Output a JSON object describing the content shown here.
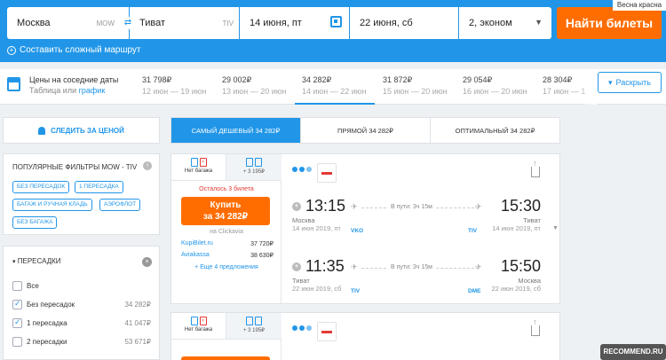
{
  "watermark_top": "Весна красна",
  "search": {
    "from_city": "Москва",
    "from_iata": "MOW",
    "to_city": "Тиват",
    "to_iata": "TIV",
    "depart_date": "14 июня, пт",
    "return_date": "22 июня, сб",
    "passengers": "2, эконом",
    "search_label": "Найти билеты",
    "complex_route": "Составить сложный маршрут"
  },
  "price_strip": {
    "title": "Цены на соседние даты",
    "sub_prefix": "Таблица или ",
    "sub_link": "график",
    "expand_label": "Раскрыть",
    "cells": [
      {
        "price": "31 798₽",
        "dates": "12 июн — 19 июн"
      },
      {
        "price": "29 002₽",
        "dates": "13 июн — 20 июн"
      },
      {
        "price": "34 282₽",
        "dates": "14 июн — 22 июн"
      },
      {
        "price": "31 872₽",
        "dates": "15 июн — 20 июн"
      },
      {
        "price": "29 054₽",
        "dates": "16 июн — 20 июн"
      },
      {
        "price": "28 304₽",
        "dates": "17 июн — 1"
      }
    ]
  },
  "follow_price": "СЛЕДИТЬ ЗА ЦЕНОЙ",
  "popular_filters": {
    "title": "ПОПУЛЯРНЫЕ ФИЛЬТРЫ MOW - TIV",
    "chips": [
      "БЕЗ ПЕРЕСАДОК",
      "1 ПЕРЕСАДКА",
      "БАГАЖ И РУЧНАЯ КЛАДЬ",
      "АЭРОФЛОТ",
      "БЕЗ БАГАЖА"
    ]
  },
  "transfers": {
    "title": "ПЕРЕСАДКИ",
    "options": [
      {
        "label": "Все",
        "value": ""
      },
      {
        "label": "Без пересадок",
        "value": "34 282₽"
      },
      {
        "label": "1 пересадка",
        "value": "41 047₽"
      },
      {
        "label": "2 пересадки",
        "value": "53 671₽"
      }
    ]
  },
  "sort_tabs": [
    "САМЫЙ ДЕШЕВЫЙ 34 282₽",
    "ПРЯМОЙ 34 282₽",
    "ОПТИМАЛЬНЫЙ 34 282₽"
  ],
  "ticket": {
    "bag_none": "Нет багажа",
    "bag_extra": "+ 3 195₽",
    "tickets_left": "Осталось 3 билета",
    "buy_line1": "Купить",
    "buy_line2": "за 34 282₽",
    "via": "на Clickavia",
    "agents": [
      {
        "name": "KupiBilet.ru",
        "price": "37 720₽"
      },
      {
        "name": "Aviakassa",
        "price": "38 630₽"
      }
    ],
    "more_offers": "+ Еще 4 предложения",
    "outbound": {
      "dep_time": "13:15",
      "arr_time": "15:30",
      "dep_city": "Москва",
      "arr_city": "Тиват",
      "dep_date": "14 июн 2019, пт",
      "arr_date": "14 июн 2019, пт",
      "dep_iata": "VKO",
      "arr_iata": "TIV",
      "duration": "В пути: 3ч 15м"
    },
    "return": {
      "dep_time": "11:35",
      "arr_time": "15:50",
      "dep_city": "Тиват",
      "arr_city": "Москва",
      "dep_date": "22 июн 2019, сб",
      "arr_date": "22 июн 2019, сб",
      "dep_iata": "TIV",
      "arr_iata": "DME",
      "duration": "В пути: 3ч 15м"
    }
  },
  "watermark_bottom": "RECOMMEND.RU"
}
